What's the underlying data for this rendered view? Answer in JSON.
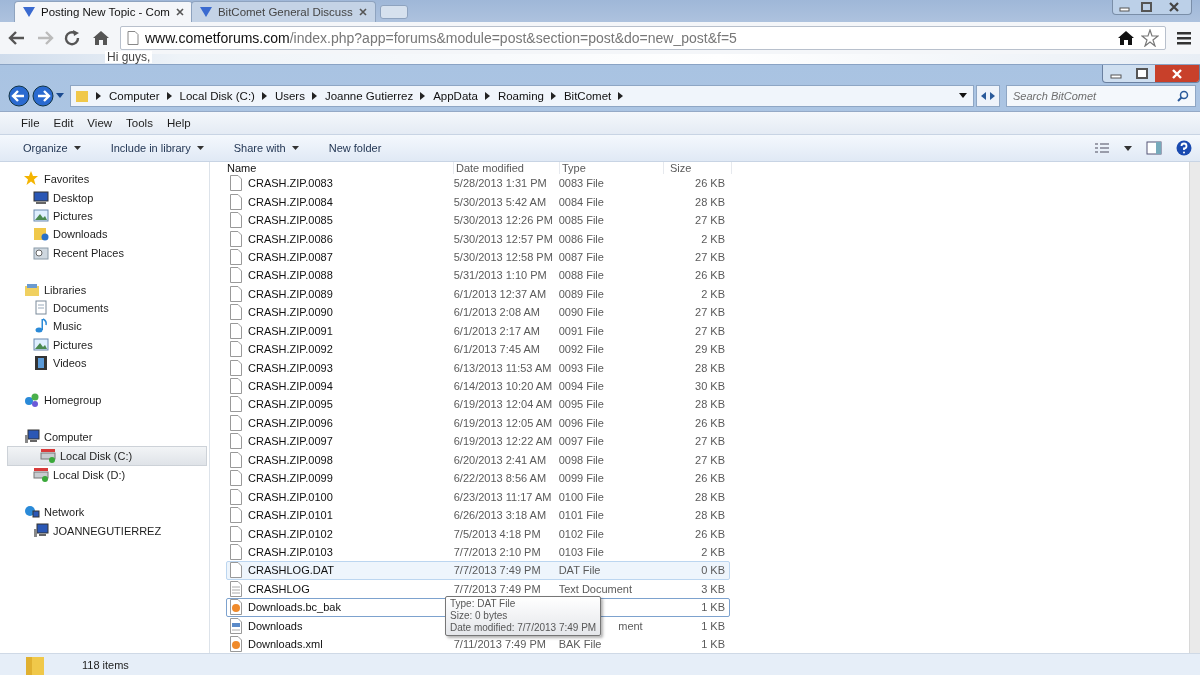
{
  "browser": {
    "tabs": [
      {
        "title": "Posting New Topic - Com",
        "selected": true
      },
      {
        "title": "BitComet General Discuss",
        "selected": false
      }
    ],
    "address": {
      "host": "www.cometforums.com",
      "path": "/index.php?app=forums&module=post&section=post&do=new_post&f=5"
    },
    "page_text": "Hi guys,"
  },
  "explorer": {
    "breadcrumb": [
      "Computer",
      "Local Disk (C:)",
      "Users",
      "Joanne Gutierrez",
      "AppData",
      "Roaming",
      "BitComet"
    ],
    "search": {
      "placeholder": "Search BitComet"
    },
    "menu": [
      "File",
      "Edit",
      "View",
      "Tools",
      "Help"
    ],
    "commands": [
      {
        "label": "Organize",
        "dropdown": true
      },
      {
        "label": "Include in library",
        "dropdown": true
      },
      {
        "label": "Share with",
        "dropdown": true
      },
      {
        "label": "New folder",
        "dropdown": false
      }
    ],
    "sidebar": [
      {
        "label": "Favorites",
        "selected": false,
        "children": [
          {
            "label": "Desktop",
            "selected": false
          },
          {
            "label": "Pictures",
            "selected": false
          },
          {
            "label": "Downloads",
            "selected": false
          },
          {
            "label": "Recent Places",
            "selected": false
          }
        ]
      },
      {
        "label": "Libraries",
        "selected": false,
        "children": [
          {
            "label": "Documents",
            "selected": false
          },
          {
            "label": "Music",
            "selected": false
          },
          {
            "label": "Pictures",
            "selected": false
          },
          {
            "label": "Videos",
            "selected": false
          }
        ]
      },
      {
        "label": "Homegroup",
        "selected": false
      },
      {
        "label": "Computer",
        "selected": false,
        "children": [
          {
            "label": "Local Disk (C:)",
            "selected": true
          },
          {
            "label": "Local Disk (D:)",
            "selected": false
          }
        ]
      },
      {
        "label": "Network",
        "selected": false,
        "children": [
          {
            "label": "JOANNEGUTIERREZ",
            "selected": false
          }
        ]
      }
    ],
    "columns": [
      "Name",
      "Date modified",
      "Type",
      "Size"
    ],
    "rows": [
      {
        "kind": "file",
        "name": "CRASH.ZIP.0083",
        "date": "5/28/2013 1:31 PM",
        "type": "0083 File",
        "size": "26 KB",
        "hovered": false,
        "focused": false
      },
      {
        "kind": "file",
        "name": "CRASH.ZIP.0084",
        "date": "5/30/2013 5:42 AM",
        "type": "0084 File",
        "size": "28 KB",
        "hovered": false,
        "focused": false
      },
      {
        "kind": "file",
        "name": "CRASH.ZIP.0085",
        "date": "5/30/2013 12:26 PM",
        "type": "0085 File",
        "size": "27 KB",
        "hovered": false,
        "focused": false
      },
      {
        "kind": "file",
        "name": "CRASH.ZIP.0086",
        "date": "5/30/2013 12:57 PM",
        "type": "0086 File",
        "size": "2 KB",
        "hovered": false,
        "focused": false
      },
      {
        "kind": "file",
        "name": "CRASH.ZIP.0087",
        "date": "5/30/2013 12:58 PM",
        "type": "0087 File",
        "size": "27 KB",
        "hovered": false,
        "focused": false
      },
      {
        "kind": "file",
        "name": "CRASH.ZIP.0088",
        "date": "5/31/2013 1:10 PM",
        "type": "0088 File",
        "size": "26 KB",
        "hovered": false,
        "focused": false
      },
      {
        "kind": "file",
        "name": "CRASH.ZIP.0089",
        "date": "6/1/2013 12:37 AM",
        "type": "0089 File",
        "size": "2 KB",
        "hovered": false,
        "focused": false
      },
      {
        "kind": "file",
        "name": "CRASH.ZIP.0090",
        "date": "6/1/2013 2:08 AM",
        "type": "0090 File",
        "size": "27 KB",
        "hovered": false,
        "focused": false
      },
      {
        "kind": "file",
        "name": "CRASH.ZIP.0091",
        "date": "6/1/2013 2:17 AM",
        "type": "0091 File",
        "size": "27 KB",
        "hovered": false,
        "focused": false
      },
      {
        "kind": "file",
        "name": "CRASH.ZIP.0092",
        "date": "6/1/2013 7:45 AM",
        "type": "0092 File",
        "size": "29 KB",
        "hovered": false,
        "focused": false
      },
      {
        "kind": "file",
        "name": "CRASH.ZIP.0093",
        "date": "6/13/2013 11:53 AM",
        "type": "0093 File",
        "size": "28 KB",
        "hovered": false,
        "focused": false
      },
      {
        "kind": "file",
        "name": "CRASH.ZIP.0094",
        "date": "6/14/2013 10:20 AM",
        "type": "0094 File",
        "size": "30 KB",
        "hovered": false,
        "focused": false
      },
      {
        "kind": "file",
        "name": "CRASH.ZIP.0095",
        "date": "6/19/2013 12:04 AM",
        "type": "0095 File",
        "size": "28 KB",
        "hovered": false,
        "focused": false
      },
      {
        "kind": "file",
        "name": "CRASH.ZIP.0096",
        "date": "6/19/2013 12:05 AM",
        "type": "0096 File",
        "size": "26 KB",
        "hovered": false,
        "focused": false
      },
      {
        "kind": "file",
        "name": "CRASH.ZIP.0097",
        "date": "6/19/2013 12:22 AM",
        "type": "0097 File",
        "size": "27 KB",
        "hovered": false,
        "focused": false
      },
      {
        "kind": "file",
        "name": "CRASH.ZIP.0098",
        "date": "6/20/2013 2:41 AM",
        "type": "0098 File",
        "size": "27 KB",
        "hovered": false,
        "focused": false
      },
      {
        "kind": "file",
        "name": "CRASH.ZIP.0099",
        "date": "6/22/2013 8:56 AM",
        "type": "0099 File",
        "size": "26 KB",
        "hovered": false,
        "focused": false
      },
      {
        "kind": "file",
        "name": "CRASH.ZIP.0100",
        "date": "6/23/2013 11:17 AM",
        "type": "0100 File",
        "size": "28 KB",
        "hovered": false,
        "focused": false
      },
      {
        "kind": "file",
        "name": "CRASH.ZIP.0101",
        "date": "6/26/2013 3:18 AM",
        "type": "0101 File",
        "size": "28 KB",
        "hovered": false,
        "focused": false
      },
      {
        "kind": "file",
        "name": "CRASH.ZIP.0102",
        "date": "7/5/2013 4:18 PM",
        "type": "0102 File",
        "size": "26 KB",
        "hovered": false,
        "focused": false
      },
      {
        "kind": "file",
        "name": "CRASH.ZIP.0103",
        "date": "7/7/2013 2:10 PM",
        "type": "0103 File",
        "size": "2 KB",
        "hovered": false,
        "focused": false
      },
      {
        "kind": "file",
        "name": "CRASHLOG.DAT",
        "date": "7/7/2013 7:49 PM",
        "type": "DAT File",
        "size": "0 KB",
        "hovered": true,
        "focused": false
      },
      {
        "kind": "text",
        "name": "CRASHLOG",
        "date": "7/7/2013 7:49 PM",
        "type": "Text Document",
        "size": "3 KB",
        "hovered": false,
        "focused": false
      },
      {
        "kind": "bak",
        "name": "Downloads.bc_bak",
        "size": "1 KB",
        "hovered": false,
        "focused": true
      },
      {
        "kind": "xml",
        "name": "Downloads",
        "type": "ment",
        "size": "1 KB",
        "hovered": false,
        "focused": false
      },
      {
        "kind": "bak",
        "name": "Downloads.xml",
        "date": "7/11/2013 7:49 PM",
        "type": "BAK File",
        "size": "1 KB",
        "hovered": false,
        "focused": false
      }
    ],
    "tooltip": [
      "Type: DAT File",
      "Size: 0 bytes",
      "Date modified: 7/7/2013 7:49 PM"
    ],
    "status": "118 items"
  }
}
